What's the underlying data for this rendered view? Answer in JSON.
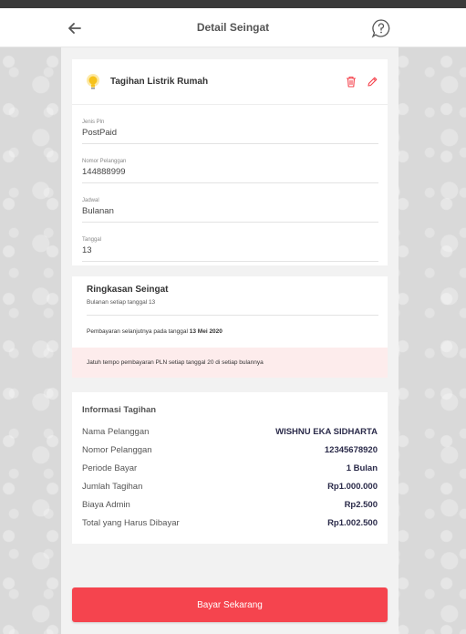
{
  "header": {
    "title": "Detail Seingat",
    "back_icon": "arrow-left-icon",
    "help_icon": "help-chat-icon"
  },
  "reminder": {
    "name": "Tagihan Listrik Rumah",
    "icon": "lightbulb-icon",
    "fields": [
      {
        "label": "Jenis Pln",
        "value": "PostPaid"
      },
      {
        "label": "Nomor Pelanggan",
        "value": "144888999"
      },
      {
        "label": "Jadwal",
        "value": "Bulanan"
      },
      {
        "label": "Tanggal",
        "value": "13"
      }
    ]
  },
  "summary": {
    "title": "Ringkasan Seingat",
    "subtitle": "Bulanan setiap tanggal 13",
    "next_prefix": "Pembayaran selanjutnya pada tanggal",
    "next_date": "13 Mei 2020",
    "warning": "Jatuh tempo pembayaran PLN setiap tanggal 20 di setiap bulannya"
  },
  "bill": {
    "title": "Informasi Tagihan",
    "rows": [
      {
        "key": "Nama Pelanggan",
        "value": "WISHNU EKA SIDHARTA"
      },
      {
        "key": "Nomor Pelanggan",
        "value": "12345678920"
      },
      {
        "key": "Periode Bayar",
        "value": "1 Bulan"
      },
      {
        "key": "Jumlah Tagihan",
        "value": "Rp1.000.000"
      },
      {
        "key": "Biaya Admin",
        "value": "Rp2.500"
      },
      {
        "key": "Total yang Harus Dibayar",
        "value": "Rp1.002.500"
      }
    ]
  },
  "pay_button": "Bayar Sekarang",
  "colors": {
    "accent": "#f5444e",
    "warning_bg": "#fdecec",
    "value_text": "#2b2b4a"
  }
}
